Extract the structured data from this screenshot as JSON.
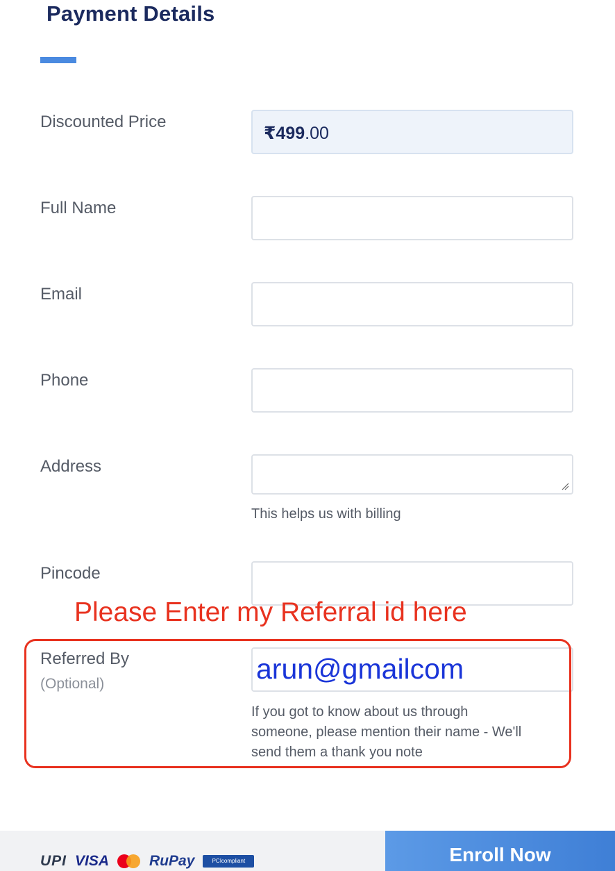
{
  "header": {
    "title": "Payment Details"
  },
  "form": {
    "discounted_price": {
      "label": "Discounted Price",
      "currency_symbol": "₹",
      "amount_main": "499",
      "amount_decimal": ".00"
    },
    "full_name": {
      "label": "Full Name",
      "value": ""
    },
    "email": {
      "label": "Email",
      "value": ""
    },
    "phone": {
      "label": "Phone",
      "value": ""
    },
    "address": {
      "label": "Address",
      "value": "",
      "helper": "This helps us with billing"
    },
    "pincode": {
      "label": "Pincode",
      "value": ""
    },
    "referred_by": {
      "label": "Referred By",
      "optional": "(Optional)",
      "value": "arun@gmailcom",
      "helper_line1": "If you got to know about us through",
      "helper_line2": "someone, please mention their name - We'll",
      "helper_line3": "send them a thank you note"
    }
  },
  "annotation": {
    "text": "Please Enter my Referral id here",
    "color": "#e8321f"
  },
  "footer": {
    "payment_logos": [
      "UPI",
      "VISA",
      "mastercard-icon",
      "RuPay",
      "PCIcompliant"
    ],
    "upi_label": "UPI",
    "visa_label": "VISA",
    "rupay_label": "RuPay",
    "pci_label": "PCIcompliant",
    "enroll_button": "Enroll Now"
  },
  "colors": {
    "title": "#1b2a5e",
    "accent": "#4a8ae0",
    "button": "#4a8ae0"
  }
}
